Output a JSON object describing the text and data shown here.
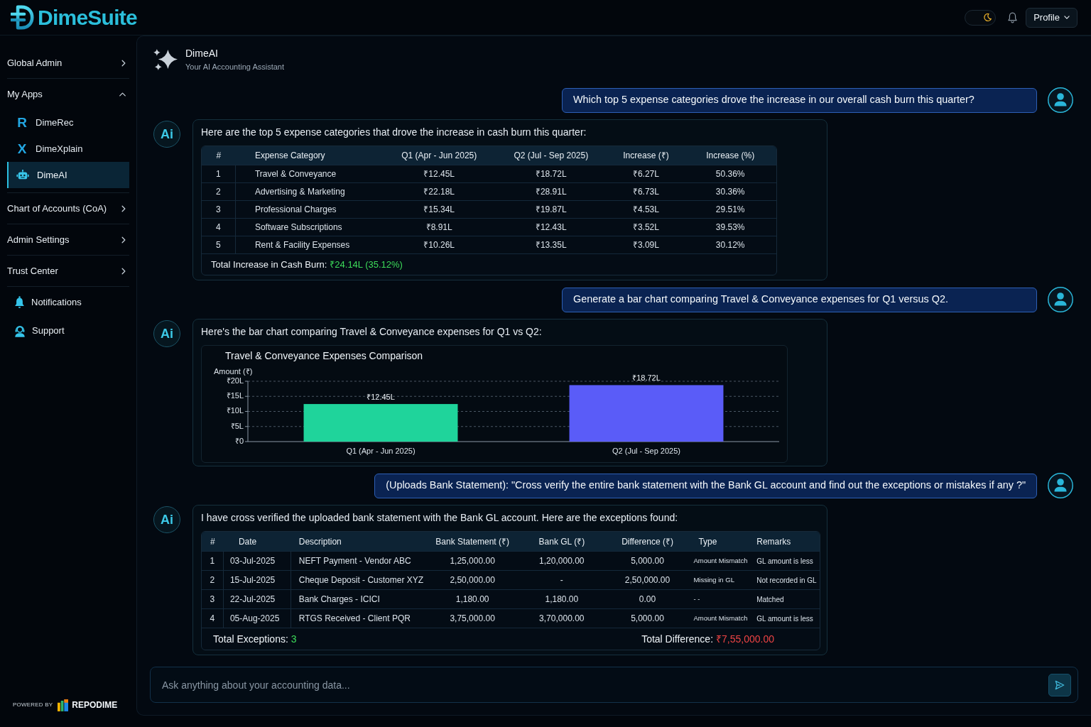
{
  "header": {
    "logo": "DimeSuite",
    "dark_mode": true,
    "profile_label": "Profile"
  },
  "sidebar": {
    "items": [
      {
        "kind": "group",
        "label": "Global Admin",
        "expanded": false
      },
      {
        "kind": "group",
        "label": "My Apps",
        "expanded": true,
        "children": [
          {
            "kind": "letter",
            "logo_letter": "R",
            "label": "DimeRec",
            "selected": false
          },
          {
            "kind": "letter",
            "logo_letter": "X",
            "label": "DimeXplain",
            "selected": false
          },
          {
            "kind": "bot",
            "label": "DimeAI",
            "selected": true
          }
        ]
      },
      {
        "kind": "group",
        "label": "Chart of Accounts (CoA)",
        "expanded": false
      },
      {
        "kind": "group",
        "label": "Admin Settings",
        "expanded": false
      },
      {
        "kind": "group",
        "label": "Trust Center",
        "expanded": false
      },
      {
        "kind": "link",
        "label": "Notifications"
      },
      {
        "kind": "link",
        "label": "Support"
      }
    ],
    "footer": {
      "powered_by": "POWERED BY",
      "brand": "REPODIME"
    }
  },
  "assistant": {
    "title": "DimeAI",
    "subtitle": "Your AI Accounting Assistant"
  },
  "messages": [
    {
      "kind": "user",
      "text": "Which top 5 expense categories drove the increase in our overall cash burn this quarter?"
    },
    {
      "kind": "expense_table",
      "avatar": "Ai",
      "intro": "Here are the top 5 expense categories that drove the increase in cash burn this quarter:",
      "table": {
        "columns": [
          "#",
          "Expense Category",
          "Q1 (Apr - Jun 2025)",
          "Q2 (Jul - Sep 2025)",
          "Increase (₹)",
          "Increase (%)"
        ],
        "rows": [
          [
            "1",
            "Travel & Conveyance",
            "₹12.45L",
            "₹18.72L",
            "₹6.27L",
            "50.36%"
          ],
          [
            "2",
            "Advertising & Marketing",
            "₹22.18L",
            "₹28.91L",
            "₹6.73L",
            "30.36%"
          ],
          [
            "3",
            "Professional Charges",
            "₹15.34L",
            "₹19.87L",
            "₹4.53L",
            "29.51%"
          ],
          [
            "4",
            "Software Subscriptions",
            "₹8.91L",
            "₹12.43L",
            "₹3.52L",
            "39.53%"
          ],
          [
            "5",
            "Rent & Facility Expenses",
            "₹10.26L",
            "₹13.35L",
            "₹3.09L",
            "30.12%"
          ]
        ],
        "totals": [
          {
            "label": "Total Increase in Cash Burn:",
            "value": "₹24.14L (35.12%)",
            "color": "#3ddc5a"
          }
        ]
      }
    },
    {
      "kind": "user",
      "text": "Generate a bar chart comparing Travel & Conveyance expenses for Q1 versus Q2."
    },
    {
      "kind": "bar_chart",
      "avatar": "Ai",
      "intro": "Here's the bar chart comparing Travel & Conveyance expenses for Q1 vs Q2:",
      "chart_data": {
        "type": "bar",
        "title": "Travel & Conveyance Expenses Comparison",
        "ylabel": "Amount (₹)",
        "categories": [
          "Q1 (Apr - Jun 2025)",
          "Q2 (Jul - Sep 2025)"
        ],
        "values": [
          12.45,
          18.72
        ],
        "colors": [
          "#1fd49b",
          "#5a5cf8"
        ],
        "ylim": [
          0,
          20
        ],
        "yticks": [
          {
            "value": 0,
            "label": "₹0"
          },
          {
            "value": 5,
            "label": "₹5L"
          },
          {
            "value": 10,
            "label": "₹10L"
          },
          {
            "value": 15,
            "label": "₹15L"
          },
          {
            "value": 20,
            "label": "₹20L"
          }
        ],
        "grid": true,
        "value_labels": [
          "₹12.45L",
          "₹18.72L"
        ]
      }
    },
    {
      "kind": "user",
      "text": "(Uploads Bank Statement): \"Cross verify the entire bank statement with the Bank GL account and find out the exceptions or mistakes if any ?\""
    },
    {
      "kind": "exceptions_table",
      "avatar": "Ai",
      "intro": "I have cross verified the uploaded bank statement with the Bank GL account. Here are the exceptions found:",
      "table": {
        "columns": [
          "#",
          "Date",
          "Description",
          "Bank Statement (₹)",
          "Bank GL (₹)",
          "Difference (₹)",
          "Type",
          "Remarks"
        ],
        "rows": [
          [
            "1",
            "03-Jul-2025",
            "NEFT Payment - Vendor ABC",
            "1,25,000.00",
            "1,20,000.00",
            "5,000.00",
            "Amount Mismatch",
            "GL amount is less"
          ],
          [
            "2",
            "15-Jul-2025",
            "Cheque Deposit - Customer XYZ",
            "2,50,000.00",
            "-",
            "2,50,000.00",
            "Missing in GL",
            "Not recorded in GL"
          ],
          [
            "3",
            "22-Jul-2025",
            "Bank Charges - ICICI",
            "1,180.00",
            "1,180.00",
            "0.00",
            "- -",
            "Matched"
          ],
          [
            "4",
            "05-Aug-2025",
            "RTGS Received - Client PQR",
            "3,75,000.00",
            "3,70,000.00",
            "5,000.00",
            "Amount Mismatch",
            "GL amount is less"
          ]
        ],
        "totals": [
          {
            "label": "Total Exceptions:",
            "value": "3",
            "color": "#3ddc5a"
          },
          {
            "label": "Total Difference:",
            "value": "₹7,55,000.00",
            "color": "#ef4444"
          }
        ]
      }
    }
  ],
  "composer": {
    "placeholder": "Ask anything about your accounting data..."
  }
}
